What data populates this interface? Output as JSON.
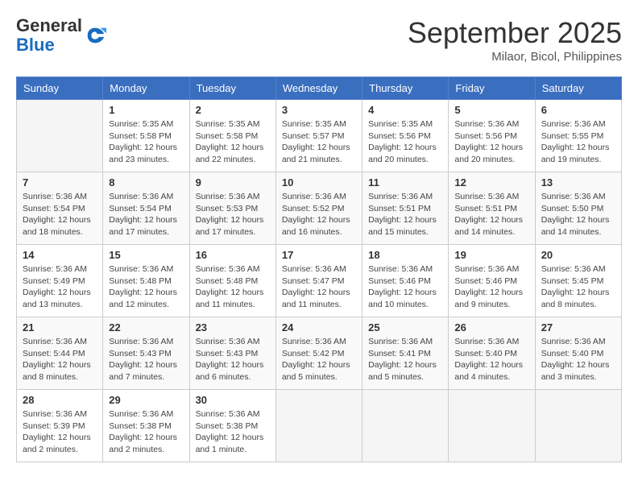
{
  "header": {
    "logo_general": "General",
    "logo_blue": "Blue",
    "month_title": "September 2025",
    "location": "Milaor, Bicol, Philippines"
  },
  "days_of_week": [
    "Sunday",
    "Monday",
    "Tuesday",
    "Wednesday",
    "Thursday",
    "Friday",
    "Saturday"
  ],
  "weeks": [
    [
      {
        "day": "",
        "info": ""
      },
      {
        "day": "1",
        "info": "Sunrise: 5:35 AM\nSunset: 5:58 PM\nDaylight: 12 hours\nand 23 minutes."
      },
      {
        "day": "2",
        "info": "Sunrise: 5:35 AM\nSunset: 5:58 PM\nDaylight: 12 hours\nand 22 minutes."
      },
      {
        "day": "3",
        "info": "Sunrise: 5:35 AM\nSunset: 5:57 PM\nDaylight: 12 hours\nand 21 minutes."
      },
      {
        "day": "4",
        "info": "Sunrise: 5:35 AM\nSunset: 5:56 PM\nDaylight: 12 hours\nand 20 minutes."
      },
      {
        "day": "5",
        "info": "Sunrise: 5:36 AM\nSunset: 5:56 PM\nDaylight: 12 hours\nand 20 minutes."
      },
      {
        "day": "6",
        "info": "Sunrise: 5:36 AM\nSunset: 5:55 PM\nDaylight: 12 hours\nand 19 minutes."
      }
    ],
    [
      {
        "day": "7",
        "info": "Sunrise: 5:36 AM\nSunset: 5:54 PM\nDaylight: 12 hours\nand 18 minutes."
      },
      {
        "day": "8",
        "info": "Sunrise: 5:36 AM\nSunset: 5:54 PM\nDaylight: 12 hours\nand 17 minutes."
      },
      {
        "day": "9",
        "info": "Sunrise: 5:36 AM\nSunset: 5:53 PM\nDaylight: 12 hours\nand 17 minutes."
      },
      {
        "day": "10",
        "info": "Sunrise: 5:36 AM\nSunset: 5:52 PM\nDaylight: 12 hours\nand 16 minutes."
      },
      {
        "day": "11",
        "info": "Sunrise: 5:36 AM\nSunset: 5:51 PM\nDaylight: 12 hours\nand 15 minutes."
      },
      {
        "day": "12",
        "info": "Sunrise: 5:36 AM\nSunset: 5:51 PM\nDaylight: 12 hours\nand 14 minutes."
      },
      {
        "day": "13",
        "info": "Sunrise: 5:36 AM\nSunset: 5:50 PM\nDaylight: 12 hours\nand 14 minutes."
      }
    ],
    [
      {
        "day": "14",
        "info": "Sunrise: 5:36 AM\nSunset: 5:49 PM\nDaylight: 12 hours\nand 13 minutes."
      },
      {
        "day": "15",
        "info": "Sunrise: 5:36 AM\nSunset: 5:48 PM\nDaylight: 12 hours\nand 12 minutes."
      },
      {
        "day": "16",
        "info": "Sunrise: 5:36 AM\nSunset: 5:48 PM\nDaylight: 12 hours\nand 11 minutes."
      },
      {
        "day": "17",
        "info": "Sunrise: 5:36 AM\nSunset: 5:47 PM\nDaylight: 12 hours\nand 11 minutes."
      },
      {
        "day": "18",
        "info": "Sunrise: 5:36 AM\nSunset: 5:46 PM\nDaylight: 12 hours\nand 10 minutes."
      },
      {
        "day": "19",
        "info": "Sunrise: 5:36 AM\nSunset: 5:46 PM\nDaylight: 12 hours\nand 9 minutes."
      },
      {
        "day": "20",
        "info": "Sunrise: 5:36 AM\nSunset: 5:45 PM\nDaylight: 12 hours\nand 8 minutes."
      }
    ],
    [
      {
        "day": "21",
        "info": "Sunrise: 5:36 AM\nSunset: 5:44 PM\nDaylight: 12 hours\nand 8 minutes."
      },
      {
        "day": "22",
        "info": "Sunrise: 5:36 AM\nSunset: 5:43 PM\nDaylight: 12 hours\nand 7 minutes."
      },
      {
        "day": "23",
        "info": "Sunrise: 5:36 AM\nSunset: 5:43 PM\nDaylight: 12 hours\nand 6 minutes."
      },
      {
        "day": "24",
        "info": "Sunrise: 5:36 AM\nSunset: 5:42 PM\nDaylight: 12 hours\nand 5 minutes."
      },
      {
        "day": "25",
        "info": "Sunrise: 5:36 AM\nSunset: 5:41 PM\nDaylight: 12 hours\nand 5 minutes."
      },
      {
        "day": "26",
        "info": "Sunrise: 5:36 AM\nSunset: 5:40 PM\nDaylight: 12 hours\nand 4 minutes."
      },
      {
        "day": "27",
        "info": "Sunrise: 5:36 AM\nSunset: 5:40 PM\nDaylight: 12 hours\nand 3 minutes."
      }
    ],
    [
      {
        "day": "28",
        "info": "Sunrise: 5:36 AM\nSunset: 5:39 PM\nDaylight: 12 hours\nand 2 minutes."
      },
      {
        "day": "29",
        "info": "Sunrise: 5:36 AM\nSunset: 5:38 PM\nDaylight: 12 hours\nand 2 minutes."
      },
      {
        "day": "30",
        "info": "Sunrise: 5:36 AM\nSunset: 5:38 PM\nDaylight: 12 hours\nand 1 minute."
      },
      {
        "day": "",
        "info": ""
      },
      {
        "day": "",
        "info": ""
      },
      {
        "day": "",
        "info": ""
      },
      {
        "day": "",
        "info": ""
      }
    ]
  ]
}
